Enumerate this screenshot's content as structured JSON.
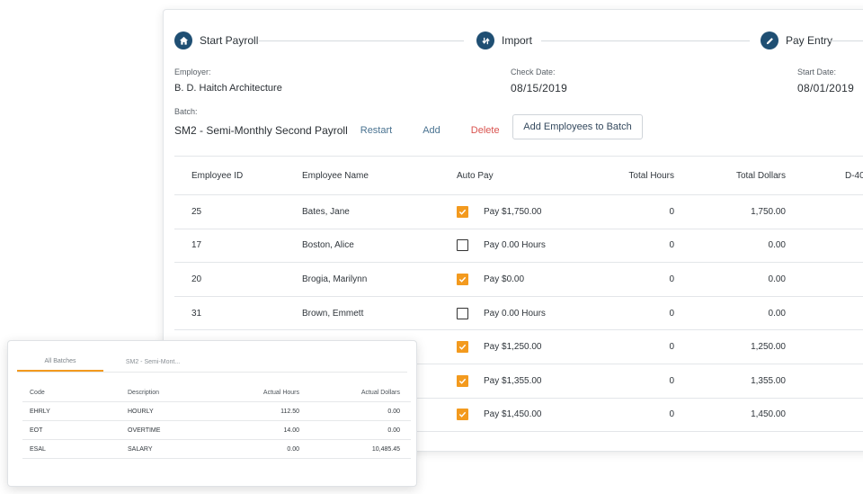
{
  "stepper": [
    {
      "label": "Start Payroll",
      "icon": "home-icon"
    },
    {
      "label": "Import",
      "icon": "import-icon"
    },
    {
      "label": "Pay Entry",
      "icon": "pencil-icon"
    }
  ],
  "employer": {
    "label": "Employer:",
    "value": "B. D. Haitch Architecture"
  },
  "check_date": {
    "label": "Check Date:",
    "value": "08/15/2019"
  },
  "start_date": {
    "label": "Start Date:",
    "value": "08/01/2019"
  },
  "batch": {
    "label": "Batch:",
    "value": "SM2 - Semi-Monthly Second Payroll",
    "restart": "Restart",
    "add": "Add",
    "delete": "Delete",
    "add_employees": "Add Employees to Batch"
  },
  "grid": {
    "headers": {
      "id": "Employee ID",
      "name": "Employee Name",
      "auto": "Auto Pay",
      "hours": "Total Hours",
      "dollars": "Total Dollars",
      "d40": "D-40"
    },
    "rows": [
      {
        "id": "25",
        "name": "Bates, Jane",
        "checked": true,
        "auto": "Pay $1,750.00",
        "hours": "0",
        "dollars": "1,750.00"
      },
      {
        "id": "17",
        "name": "Boston, Alice",
        "checked": false,
        "auto": "Pay 0.00 Hours",
        "hours": "0",
        "dollars": "0.00"
      },
      {
        "id": "20",
        "name": "Brogia, Marilynn",
        "checked": true,
        "auto": "Pay $0.00",
        "hours": "0",
        "dollars": "0.00"
      },
      {
        "id": "31",
        "name": "Brown, Emmett",
        "checked": false,
        "auto": "Pay 0.00 Hours",
        "hours": "0",
        "dollars": "0.00"
      },
      {
        "id": "",
        "name": "",
        "checked": true,
        "auto": "Pay $1,250.00",
        "hours": "0",
        "dollars": "1,250.00"
      },
      {
        "id": "",
        "name": "",
        "checked": true,
        "auto": "Pay $1,355.00",
        "hours": "0",
        "dollars": "1,355.00"
      },
      {
        "id": "",
        "name": "",
        "checked": true,
        "auto": "Pay $1,450.00",
        "hours": "0",
        "dollars": "1,450.00"
      }
    ]
  },
  "colors": {
    "accent": "#f39a1e",
    "step": "#1f4f73",
    "danger": "#d9534f",
    "link": "#4a7391"
  },
  "summary": {
    "tabs": [
      "All Batches",
      "SM2 - Semi-Mont..."
    ],
    "headers": {
      "code": "Code",
      "desc": "Description",
      "hours": "Actual Hours",
      "dollars": "Actual Dollars"
    },
    "rows": [
      {
        "code": "EHRLY",
        "desc": "HOURLY",
        "hours": "112.50",
        "dollars": "0.00"
      },
      {
        "code": "EOT",
        "desc": "OVERTIME",
        "hours": "14.00",
        "dollars": "0.00"
      },
      {
        "code": "ESAL",
        "desc": "SALARY",
        "hours": "0.00",
        "dollars": "10,485.45"
      }
    ]
  }
}
